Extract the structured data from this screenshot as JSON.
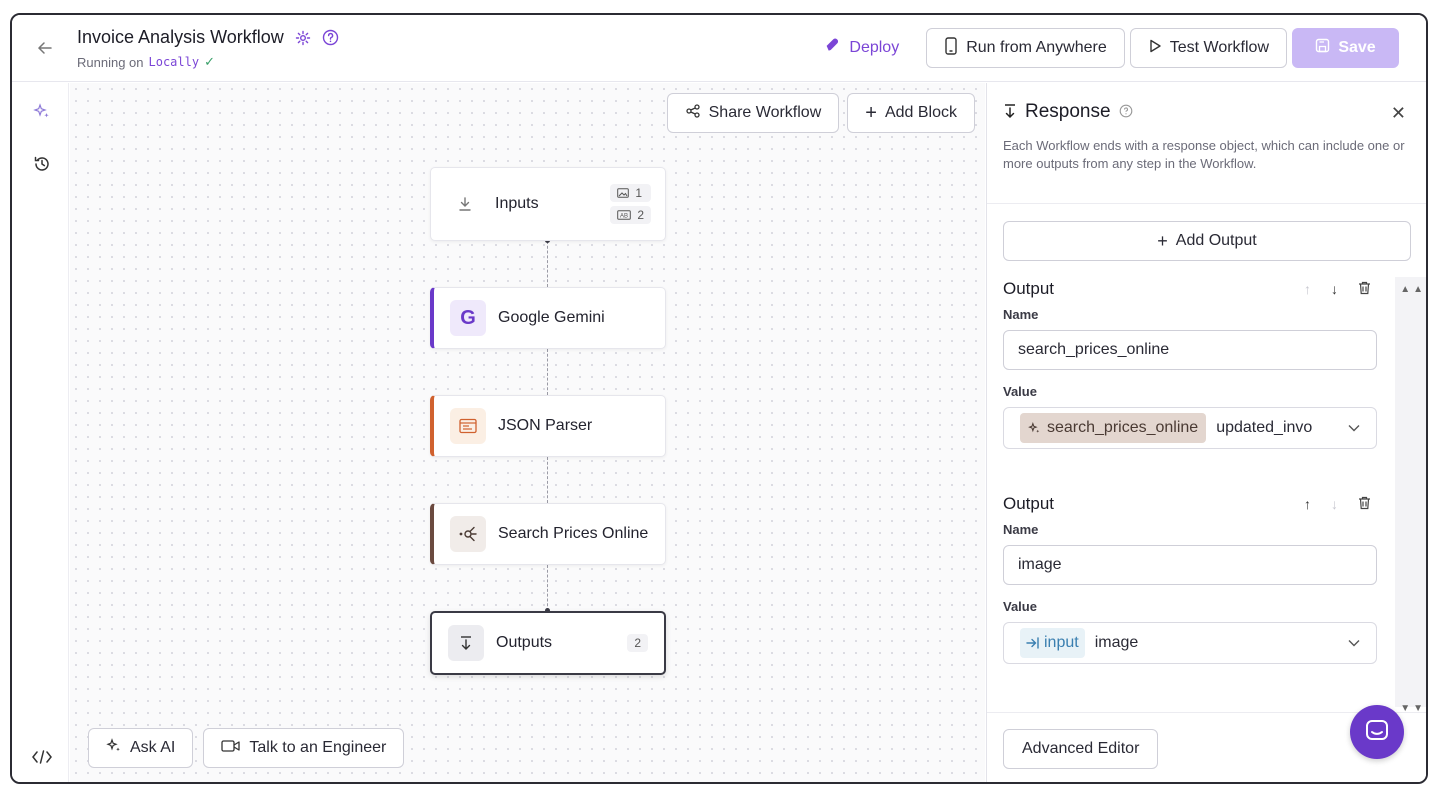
{
  "header": {
    "title": "Invoice Analysis Workflow",
    "subtitle_prefix": "Running on",
    "subtitle_env": "Locally",
    "deploy_label": "Deploy",
    "run_anywhere_label": "Run from Anywhere",
    "test_label": "Test Workflow",
    "save_label": "Save"
  },
  "canvas": {
    "share_label": "Share Workflow",
    "add_block_label": "Add Block",
    "nodes": [
      {
        "label": "Inputs",
        "badge_image": "1",
        "badge_text": "2"
      },
      {
        "label": "Google Gemini",
        "accent": "#6a39c9"
      },
      {
        "label": "JSON Parser",
        "accent": "#d0612e"
      },
      {
        "label": "Search Prices Online",
        "accent": "#6b4a3f"
      },
      {
        "label": "Outputs",
        "badge": "2"
      }
    ],
    "ask_ai_label": "Ask AI",
    "talk_engineer_label": "Talk to an Engineer"
  },
  "panel": {
    "title": "Response",
    "description": "Each Workflow ends with a response object, which can include one or more outputs from any step in the Workflow.",
    "add_output_label": "Add Output",
    "name_label": "Name",
    "value_label": "Value",
    "outputs": [
      {
        "title": "Output",
        "name": "search_prices_online",
        "chip": "search_prices_online",
        "value": "updated_invo"
      },
      {
        "title": "Output",
        "name": "image",
        "chip": "input",
        "value": "image"
      }
    ],
    "advanced_label": "Advanced Editor"
  },
  "colors": {
    "accent": "#7b45d6",
    "save_disabled": "#c9b8f5",
    "chat_bubble": "#6a39c9"
  }
}
